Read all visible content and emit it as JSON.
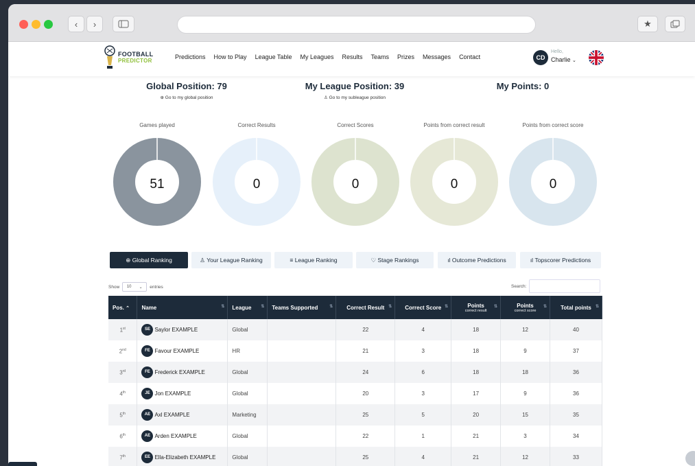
{
  "nav": {
    "logo_line1": "FOOTBALL",
    "logo_line2": "PREDICTOR",
    "links": [
      "Predictions",
      "How to Play",
      "League Table",
      "My Leagues",
      "Results",
      "Teams",
      "Prizes",
      "Messages",
      "Contact"
    ],
    "avatar_initials": "CD",
    "greeting": "Hello,",
    "user_name": "Charlie"
  },
  "positions": {
    "global_title": "Global Position: 79",
    "global_link": "Go to my global position",
    "league_title": "My League Position: 39",
    "league_link": "Go to my subleague position",
    "points_title": "My Points: 0"
  },
  "stats": [
    {
      "label": "Games played",
      "value": "51",
      "fraction": 0.98,
      "color": "#8a949e"
    },
    {
      "label": "Correct Results",
      "value": "0",
      "fraction": 0,
      "color": "#e6f0fa"
    },
    {
      "label": "Correct Scores",
      "value": "0",
      "fraction": 0,
      "color": "#dde3cf"
    },
    {
      "label": "Points from correct result",
      "value": "0",
      "fraction": 0,
      "color": "#e6e8d6"
    },
    {
      "label": "Points from correct score",
      "value": "0",
      "fraction": 0,
      "color": "#d8e5ee"
    }
  ],
  "tabs": [
    {
      "label": "Global Ranking",
      "icon": "globe-icon",
      "glyph": "⊕"
    },
    {
      "label": "Your League Ranking",
      "icon": "user-icon",
      "glyph": "♙"
    },
    {
      "label": "League Ranking",
      "icon": "list-icon",
      "glyph": "≡"
    },
    {
      "label": "Stage Rankings",
      "icon": "trophy-icon",
      "glyph": "♡"
    },
    {
      "label": "Outcome Predictions",
      "icon": "bar-chart-icon",
      "glyph": "ıl"
    },
    {
      "label": "Topscorer Predictions",
      "icon": "bar-chart-icon",
      "glyph": "ıl"
    }
  ],
  "table_controls": {
    "show_label": "Show",
    "page_size": "10",
    "entries_label": "entries",
    "search_label": "Search:"
  },
  "table": {
    "headers": [
      {
        "label": "Pos.",
        "sub": ""
      },
      {
        "label": "Name",
        "sub": ""
      },
      {
        "label": "League",
        "sub": ""
      },
      {
        "label": "Teams Supported",
        "sub": ""
      },
      {
        "label": "Correct Result",
        "sub": ""
      },
      {
        "label": "Correct Score",
        "sub": ""
      },
      {
        "label": "Points",
        "sub": "correct result"
      },
      {
        "label": "Points",
        "sub": "correct score"
      },
      {
        "label": "Total points",
        "sub": ""
      }
    ],
    "rows": [
      {
        "pos": "1",
        "suffix": "st",
        "initials": "SE",
        "name": "Saylor EXAMPLE",
        "league": "Global",
        "teams": "",
        "cr": "22",
        "cs": "4",
        "pcr": "18",
        "pcs": "12",
        "total": "40"
      },
      {
        "pos": "2",
        "suffix": "nd",
        "initials": "FE",
        "name": "Favour EXAMPLE",
        "league": "HR",
        "teams": "",
        "cr": "21",
        "cs": "3",
        "pcr": "18",
        "pcs": "9",
        "total": "37"
      },
      {
        "pos": "3",
        "suffix": "rd",
        "initials": "FE",
        "name": "Frederick EXAMPLE",
        "league": "Global",
        "teams": "",
        "cr": "24",
        "cs": "6",
        "pcr": "18",
        "pcs": "18",
        "total": "36"
      },
      {
        "pos": "4",
        "suffix": "th",
        "initials": "JE",
        "name": "Jon EXAMPLE",
        "league": "Global",
        "teams": "",
        "cr": "20",
        "cs": "3",
        "pcr": "17",
        "pcs": "9",
        "total": "36"
      },
      {
        "pos": "5",
        "suffix": "th",
        "initials": "AE",
        "name": "Axl EXAMPLE",
        "league": "Marketing",
        "teams": "",
        "cr": "25",
        "cs": "5",
        "pcr": "20",
        "pcs": "15",
        "total": "35"
      },
      {
        "pos": "6",
        "suffix": "th",
        "initials": "AE",
        "name": "Arden EXAMPLE",
        "league": "Global",
        "teams": "",
        "cr": "22",
        "cs": "1",
        "pcr": "21",
        "pcs": "3",
        "total": "34"
      },
      {
        "pos": "7",
        "suffix": "th",
        "initials": "EE",
        "name": "Ella-Elizabeth EXAMPLE",
        "league": "Global",
        "teams": "",
        "cr": "25",
        "cs": "4",
        "pcr": "21",
        "pcs": "12",
        "total": "33"
      }
    ]
  },
  "colors": {
    "primary": "#1d2b3a",
    "accent_green": "#8fbf3a"
  }
}
